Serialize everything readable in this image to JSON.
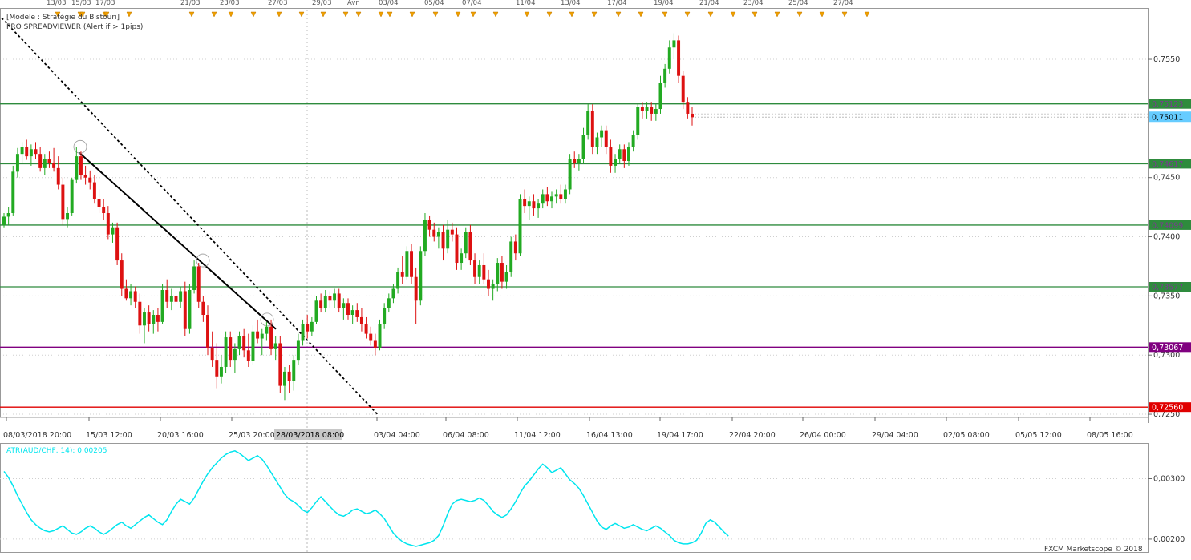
{
  "header": {
    "line1": "[Modele : Stratégie du Bistouri]",
    "line2": "PRO SPREADVIEWER (Alert if > 1pips)"
  },
  "events_axis": {
    "labels": [
      "13/03",
      "15/03",
      "17/03",
      "21/03",
      "23/03",
      "27/03",
      "29/03",
      "Avr",
      "03/04",
      "05/04",
      "07/04",
      "11/04",
      "13/04",
      "17/04",
      "19/04",
      "21/04",
      "23/04",
      "25/04",
      "27/04"
    ]
  },
  "main_axis": {
    "ticks": [
      "0,7550",
      "0,7450",
      "0,7400",
      "0,7350",
      "0,7300",
      "0,7250"
    ],
    "ylim": [
      0.7248,
      0.7592
    ]
  },
  "levels": [
    {
      "value": 0.75123,
      "label": "0,75123",
      "color": "#2e8b3d",
      "label_color": "#7a3b8f"
    },
    {
      "value": 0.74617,
      "label": "0,74617",
      "color": "#2e8b3d",
      "label_color": "#7a3b8f"
    },
    {
      "value": 0.74099,
      "label": "0,74099",
      "color": "#2e8b3d",
      "label_color": "#7a3b8f"
    },
    {
      "value": 0.73577,
      "label": "0,73577",
      "color": "#2e8b3d",
      "label_color": "#7a3b8f"
    },
    {
      "value": 0.73067,
      "label": "0,73067",
      "color": "#800080",
      "label_color": "#ffffff"
    },
    {
      "value": 0.7256,
      "label": "0,72560",
      "color": "#e00000",
      "label_color": "#ffffff"
    }
  ],
  "current_price": {
    "value": 0.75011,
    "label": "0,75011",
    "color": "#66ccff"
  },
  "time_axis": {
    "labels": [
      "08/03/2018 20:00",
      "15/03 12:00",
      "20/03 16:00",
      "25/03 20:00",
      "03/04 04:00",
      "06/04 08:00",
      "11/04 12:00",
      "16/04 13:00",
      "19/04 17:00",
      "22/04 20:00",
      "26/04 00:00",
      "29/04 04:00",
      "02/05 08:00",
      "05/05 12:00",
      "08/05 16:00"
    ],
    "cursor_label": "28/03/2018 08:00"
  },
  "indicator": {
    "label": "ATR(AUD/CHF, 14): 0,00205",
    "ticks": [
      "0,00300",
      "0,00200"
    ],
    "color": "#00e5ee"
  },
  "watermark": "FXCM Marketscope © 2018",
  "colors": {
    "bull": "#22aa22",
    "bear": "#dd1111",
    "grid": "#cfcfcf",
    "frame": "#999999"
  },
  "chart_data": {
    "type": "candlestick",
    "instrument": "AUD/CHF",
    "candles": [
      {
        "o": 0.741,
        "h": 0.742,
        "l": 0.7408,
        "c": 0.7417
      },
      {
        "o": 0.7417,
        "h": 0.7425,
        "l": 0.741,
        "c": 0.742
      },
      {
        "o": 0.742,
        "h": 0.746,
        "l": 0.7418,
        "c": 0.7455
      },
      {
        "o": 0.7455,
        "h": 0.7475,
        "l": 0.745,
        "c": 0.747
      },
      {
        "o": 0.747,
        "h": 0.748,
        "l": 0.7462,
        "c": 0.7476
      },
      {
        "o": 0.7476,
        "h": 0.7482,
        "l": 0.7465,
        "c": 0.7468
      },
      {
        "o": 0.7468,
        "h": 0.7478,
        "l": 0.746,
        "c": 0.7474
      },
      {
        "o": 0.7474,
        "h": 0.748,
        "l": 0.7466,
        "c": 0.747
      },
      {
        "o": 0.747,
        "h": 0.7476,
        "l": 0.7455,
        "c": 0.7458
      },
      {
        "o": 0.7458,
        "h": 0.747,
        "l": 0.7452,
        "c": 0.7466
      },
      {
        "o": 0.7466,
        "h": 0.7472,
        "l": 0.7458,
        "c": 0.7462
      },
      {
        "o": 0.7462,
        "h": 0.7475,
        "l": 0.7455,
        "c": 0.7458
      },
      {
        "o": 0.7458,
        "h": 0.7468,
        "l": 0.744,
        "c": 0.7444
      },
      {
        "o": 0.7444,
        "h": 0.745,
        "l": 0.741,
        "c": 0.7415
      },
      {
        "o": 0.7415,
        "h": 0.7425,
        "l": 0.7408,
        "c": 0.742
      },
      {
        "o": 0.742,
        "h": 0.745,
        "l": 0.7418,
        "c": 0.7448
      },
      {
        "o": 0.7448,
        "h": 0.7476,
        "l": 0.7445,
        "c": 0.7468
      },
      {
        "o": 0.7468,
        "h": 0.7472,
        "l": 0.7448,
        "c": 0.7452
      },
      {
        "o": 0.7452,
        "h": 0.746,
        "l": 0.7444,
        "c": 0.745
      },
      {
        "o": 0.745,
        "h": 0.7456,
        "l": 0.744,
        "c": 0.7446
      },
      {
        "o": 0.7446,
        "h": 0.7452,
        "l": 0.7428,
        "c": 0.7432
      },
      {
        "o": 0.7432,
        "h": 0.744,
        "l": 0.742,
        "c": 0.7425
      },
      {
        "o": 0.7425,
        "h": 0.7432,
        "l": 0.7414,
        "c": 0.742
      },
      {
        "o": 0.742,
        "h": 0.7426,
        "l": 0.7398,
        "c": 0.7402
      },
      {
        "o": 0.7402,
        "h": 0.7412,
        "l": 0.7395,
        "c": 0.7408
      },
      {
        "o": 0.7408,
        "h": 0.7412,
        "l": 0.7376,
        "c": 0.738
      },
      {
        "o": 0.738,
        "h": 0.7386,
        "l": 0.735,
        "c": 0.7356
      },
      {
        "o": 0.7356,
        "h": 0.7364,
        "l": 0.7346,
        "c": 0.7348
      },
      {
        "o": 0.7348,
        "h": 0.736,
        "l": 0.7342,
        "c": 0.7354
      },
      {
        "o": 0.7354,
        "h": 0.7358,
        "l": 0.734,
        "c": 0.7345
      },
      {
        "o": 0.7345,
        "h": 0.7352,
        "l": 0.7318,
        "c": 0.7325
      },
      {
        "o": 0.7325,
        "h": 0.734,
        "l": 0.731,
        "c": 0.7336
      },
      {
        "o": 0.7336,
        "h": 0.7342,
        "l": 0.732,
        "c": 0.7326
      },
      {
        "o": 0.7326,
        "h": 0.7338,
        "l": 0.7318,
        "c": 0.7334
      },
      {
        "o": 0.7334,
        "h": 0.734,
        "l": 0.732,
        "c": 0.7328
      },
      {
        "o": 0.7328,
        "h": 0.736,
        "l": 0.7326,
        "c": 0.7355
      },
      {
        "o": 0.7355,
        "h": 0.7364,
        "l": 0.734,
        "c": 0.7345
      },
      {
        "o": 0.7345,
        "h": 0.7356,
        "l": 0.7338,
        "c": 0.735
      },
      {
        "o": 0.735,
        "h": 0.7356,
        "l": 0.734,
        "c": 0.7345
      },
      {
        "o": 0.7345,
        "h": 0.7358,
        "l": 0.734,
        "c": 0.7354
      },
      {
        "o": 0.7354,
        "h": 0.7362,
        "l": 0.7316,
        "c": 0.7322
      },
      {
        "o": 0.7322,
        "h": 0.736,
        "l": 0.7318,
        "c": 0.7355
      },
      {
        "o": 0.7355,
        "h": 0.738,
        "l": 0.7352,
        "c": 0.7375
      },
      {
        "o": 0.7375,
        "h": 0.7378,
        "l": 0.734,
        "c": 0.7345
      },
      {
        "o": 0.7345,
        "h": 0.735,
        "l": 0.7328,
        "c": 0.7334
      },
      {
        "o": 0.7334,
        "h": 0.7342,
        "l": 0.73,
        "c": 0.7306
      },
      {
        "o": 0.7306,
        "h": 0.732,
        "l": 0.729,
        "c": 0.7296
      },
      {
        "o": 0.7296,
        "h": 0.731,
        "l": 0.7272,
        "c": 0.7282
      },
      {
        "o": 0.7282,
        "h": 0.73,
        "l": 0.7276,
        "c": 0.729
      },
      {
        "o": 0.729,
        "h": 0.732,
        "l": 0.7285,
        "c": 0.7315
      },
      {
        "o": 0.7315,
        "h": 0.732,
        "l": 0.729,
        "c": 0.7296
      },
      {
        "o": 0.7296,
        "h": 0.731,
        "l": 0.7285,
        "c": 0.7305
      },
      {
        "o": 0.7305,
        "h": 0.732,
        "l": 0.73,
        "c": 0.7316
      },
      {
        "o": 0.7316,
        "h": 0.7322,
        "l": 0.7298,
        "c": 0.7304
      },
      {
        "o": 0.7304,
        "h": 0.7318,
        "l": 0.729,
        "c": 0.7295
      },
      {
        "o": 0.7295,
        "h": 0.7325,
        "l": 0.7292,
        "c": 0.732
      },
      {
        "o": 0.732,
        "h": 0.733,
        "l": 0.731,
        "c": 0.7314
      },
      {
        "o": 0.7314,
        "h": 0.7322,
        "l": 0.73,
        "c": 0.7318
      },
      {
        "o": 0.7318,
        "h": 0.7328,
        "l": 0.7312,
        "c": 0.7324
      },
      {
        "o": 0.7324,
        "h": 0.733,
        "l": 0.73,
        "c": 0.7305
      },
      {
        "o": 0.7305,
        "h": 0.7316,
        "l": 0.7296,
        "c": 0.731
      },
      {
        "o": 0.731,
        "h": 0.7316,
        "l": 0.7268,
        "c": 0.7274
      },
      {
        "o": 0.7274,
        "h": 0.729,
        "l": 0.7262,
        "c": 0.7286
      },
      {
        "o": 0.7286,
        "h": 0.7292,
        "l": 0.7268,
        "c": 0.7278
      },
      {
        "o": 0.7278,
        "h": 0.73,
        "l": 0.727,
        "c": 0.7296
      },
      {
        "o": 0.7296,
        "h": 0.7318,
        "l": 0.7292,
        "c": 0.7312
      },
      {
        "o": 0.7312,
        "h": 0.733,
        "l": 0.7308,
        "c": 0.7326
      },
      {
        "o": 0.7326,
        "h": 0.7334,
        "l": 0.7314,
        "c": 0.732
      },
      {
        "o": 0.732,
        "h": 0.7332,
        "l": 0.7316,
        "c": 0.7328
      },
      {
        "o": 0.7328,
        "h": 0.735,
        "l": 0.7326,
        "c": 0.7346
      },
      {
        "o": 0.7346,
        "h": 0.7352,
        "l": 0.7336,
        "c": 0.734
      },
      {
        "o": 0.734,
        "h": 0.7355,
        "l": 0.7336,
        "c": 0.735
      },
      {
        "o": 0.735,
        "h": 0.7354,
        "l": 0.734,
        "c": 0.7346
      },
      {
        "o": 0.7346,
        "h": 0.7356,
        "l": 0.734,
        "c": 0.7352
      },
      {
        "o": 0.7352,
        "h": 0.7356,
        "l": 0.7336,
        "c": 0.734
      },
      {
        "o": 0.734,
        "h": 0.7348,
        "l": 0.733,
        "c": 0.7344
      },
      {
        "o": 0.7344,
        "h": 0.7348,
        "l": 0.733,
        "c": 0.7334
      },
      {
        "o": 0.7334,
        "h": 0.7342,
        "l": 0.7326,
        "c": 0.7338
      },
      {
        "o": 0.7338,
        "h": 0.7344,
        "l": 0.7328,
        "c": 0.7332
      },
      {
        "o": 0.7332,
        "h": 0.734,
        "l": 0.732,
        "c": 0.7326
      },
      {
        "o": 0.7326,
        "h": 0.7332,
        "l": 0.7314,
        "c": 0.7318
      },
      {
        "o": 0.7318,
        "h": 0.7324,
        "l": 0.7308,
        "c": 0.7312
      },
      {
        "o": 0.7312,
        "h": 0.7318,
        "l": 0.73,
        "c": 0.7306
      },
      {
        "o": 0.7306,
        "h": 0.733,
        "l": 0.7304,
        "c": 0.7326
      },
      {
        "o": 0.7326,
        "h": 0.7344,
        "l": 0.7322,
        "c": 0.734
      },
      {
        "o": 0.734,
        "h": 0.7352,
        "l": 0.7336,
        "c": 0.7348
      },
      {
        "o": 0.7348,
        "h": 0.736,
        "l": 0.7344,
        "c": 0.7356
      },
      {
        "o": 0.7356,
        "h": 0.7374,
        "l": 0.7352,
        "c": 0.737
      },
      {
        "o": 0.737,
        "h": 0.7384,
        "l": 0.736,
        "c": 0.7366
      },
      {
        "o": 0.7366,
        "h": 0.7392,
        "l": 0.7364,
        "c": 0.7388
      },
      {
        "o": 0.7388,
        "h": 0.7394,
        "l": 0.736,
        "c": 0.7366
      },
      {
        "o": 0.7366,
        "h": 0.7374,
        "l": 0.7326,
        "c": 0.7346
      },
      {
        "o": 0.7346,
        "h": 0.7392,
        "l": 0.7342,
        "c": 0.7388
      },
      {
        "o": 0.7388,
        "h": 0.742,
        "l": 0.7384,
        "c": 0.7414
      },
      {
        "o": 0.7414,
        "h": 0.7418,
        "l": 0.74,
        "c": 0.7406
      },
      {
        "o": 0.7406,
        "h": 0.7412,
        "l": 0.7396,
        "c": 0.74
      },
      {
        "o": 0.74,
        "h": 0.7408,
        "l": 0.739,
        "c": 0.7404
      },
      {
        "o": 0.7404,
        "h": 0.741,
        "l": 0.738,
        "c": 0.739
      },
      {
        "o": 0.739,
        "h": 0.7414,
        "l": 0.7386,
        "c": 0.7406
      },
      {
        "o": 0.7406,
        "h": 0.7412,
        "l": 0.7396,
        "c": 0.7402
      },
      {
        "o": 0.7402,
        "h": 0.7408,
        "l": 0.7372,
        "c": 0.7378
      },
      {
        "o": 0.7378,
        "h": 0.739,
        "l": 0.7372,
        "c": 0.7386
      },
      {
        "o": 0.7386,
        "h": 0.7408,
        "l": 0.7382,
        "c": 0.7404
      },
      {
        "o": 0.7404,
        "h": 0.741,
        "l": 0.7376,
        "c": 0.738
      },
      {
        "o": 0.738,
        "h": 0.7386,
        "l": 0.736,
        "c": 0.7366
      },
      {
        "o": 0.7366,
        "h": 0.738,
        "l": 0.736,
        "c": 0.7376
      },
      {
        "o": 0.7376,
        "h": 0.7386,
        "l": 0.736,
        "c": 0.7364
      },
      {
        "o": 0.7364,
        "h": 0.7372,
        "l": 0.735,
        "c": 0.7356
      },
      {
        "o": 0.7356,
        "h": 0.7364,
        "l": 0.7346,
        "c": 0.736
      },
      {
        "o": 0.736,
        "h": 0.7382,
        "l": 0.7354,
        "c": 0.7378
      },
      {
        "o": 0.7378,
        "h": 0.7384,
        "l": 0.7356,
        "c": 0.7362
      },
      {
        "o": 0.7362,
        "h": 0.7376,
        "l": 0.7356,
        "c": 0.737
      },
      {
        "o": 0.737,
        "h": 0.74,
        "l": 0.7366,
        "c": 0.7396
      },
      {
        "o": 0.7396,
        "h": 0.7402,
        "l": 0.738,
        "c": 0.7386
      },
      {
        "o": 0.7386,
        "h": 0.7436,
        "l": 0.7384,
        "c": 0.7432
      },
      {
        "o": 0.7432,
        "h": 0.744,
        "l": 0.742,
        "c": 0.7426
      },
      {
        "o": 0.7426,
        "h": 0.7434,
        "l": 0.7414,
        "c": 0.743
      },
      {
        "o": 0.743,
        "h": 0.7436,
        "l": 0.7418,
        "c": 0.7424
      },
      {
        "o": 0.7424,
        "h": 0.7432,
        "l": 0.7416,
        "c": 0.7428
      },
      {
        "o": 0.7428,
        "h": 0.744,
        "l": 0.7424,
        "c": 0.7436
      },
      {
        "o": 0.7436,
        "h": 0.7442,
        "l": 0.7426,
        "c": 0.743
      },
      {
        "o": 0.743,
        "h": 0.7438,
        "l": 0.7424,
        "c": 0.7434
      },
      {
        "o": 0.7434,
        "h": 0.744,
        "l": 0.7428,
        "c": 0.7436
      },
      {
        "o": 0.7436,
        "h": 0.7444,
        "l": 0.7428,
        "c": 0.7432
      },
      {
        "o": 0.7432,
        "h": 0.7444,
        "l": 0.7428,
        "c": 0.744
      },
      {
        "o": 0.744,
        "h": 0.747,
        "l": 0.7436,
        "c": 0.7466
      },
      {
        "o": 0.7466,
        "h": 0.7472,
        "l": 0.7458,
        "c": 0.7462
      },
      {
        "o": 0.7462,
        "h": 0.747,
        "l": 0.7456,
        "c": 0.7466
      },
      {
        "o": 0.7466,
        "h": 0.7492,
        "l": 0.7462,
        "c": 0.7486
      },
      {
        "o": 0.7486,
        "h": 0.7512,
        "l": 0.7482,
        "c": 0.7506
      },
      {
        "o": 0.7506,
        "h": 0.7512,
        "l": 0.747,
        "c": 0.7476
      },
      {
        "o": 0.7476,
        "h": 0.7488,
        "l": 0.747,
        "c": 0.7484
      },
      {
        "o": 0.7484,
        "h": 0.7494,
        "l": 0.7476,
        "c": 0.749
      },
      {
        "o": 0.749,
        "h": 0.7494,
        "l": 0.747,
        "c": 0.7476
      },
      {
        "o": 0.7476,
        "h": 0.7482,
        "l": 0.7454,
        "c": 0.746
      },
      {
        "o": 0.746,
        "h": 0.747,
        "l": 0.7454,
        "c": 0.7466
      },
      {
        "o": 0.7466,
        "h": 0.7478,
        "l": 0.7462,
        "c": 0.7474
      },
      {
        "o": 0.7474,
        "h": 0.7478,
        "l": 0.7458,
        "c": 0.7464
      },
      {
        "o": 0.7464,
        "h": 0.748,
        "l": 0.746,
        "c": 0.7476
      },
      {
        "o": 0.7476,
        "h": 0.749,
        "l": 0.7472,
        "c": 0.7486
      },
      {
        "o": 0.7486,
        "h": 0.7512,
        "l": 0.7482,
        "c": 0.751
      },
      {
        "o": 0.751,
        "h": 0.7514,
        "l": 0.75,
        "c": 0.7506
      },
      {
        "o": 0.7506,
        "h": 0.7514,
        "l": 0.75,
        "c": 0.751
      },
      {
        "o": 0.751,
        "h": 0.7514,
        "l": 0.7498,
        "c": 0.7504
      },
      {
        "o": 0.7504,
        "h": 0.7512,
        "l": 0.7498,
        "c": 0.7508
      },
      {
        "o": 0.7508,
        "h": 0.7536,
        "l": 0.7504,
        "c": 0.753
      },
      {
        "o": 0.753,
        "h": 0.7546,
        "l": 0.7526,
        "c": 0.7542
      },
      {
        "o": 0.7542,
        "h": 0.7566,
        "l": 0.7538,
        "c": 0.756
      },
      {
        "o": 0.756,
        "h": 0.7572,
        "l": 0.755,
        "c": 0.7566
      },
      {
        "o": 0.7566,
        "h": 0.757,
        "l": 0.753,
        "c": 0.7536
      },
      {
        "o": 0.7536,
        "h": 0.754,
        "l": 0.7508,
        "c": 0.7514
      },
      {
        "o": 0.7514,
        "h": 0.7518,
        "l": 0.75,
        "c": 0.7504
      },
      {
        "o": 0.7504,
        "h": 0.751,
        "l": 0.7494,
        "c": 0.7501
      }
    ],
    "atr": [
      0.00312,
      0.00302,
      0.00288,
      0.00272,
      0.00258,
      0.00244,
      0.00232,
      0.00224,
      0.00218,
      0.00214,
      0.00212,
      0.00214,
      0.00218,
      0.00222,
      0.00216,
      0.0021,
      0.00208,
      0.00212,
      0.00218,
      0.00222,
      0.00218,
      0.00212,
      0.00208,
      0.00212,
      0.00218,
      0.00224,
      0.00228,
      0.00222,
      0.00218,
      0.00224,
      0.0023,
      0.00236,
      0.0024,
      0.00234,
      0.00228,
      0.00224,
      0.00232,
      0.00246,
      0.00258,
      0.00266,
      0.00262,
      0.00258,
      0.00268,
      0.00282,
      0.00296,
      0.00308,
      0.00318,
      0.00326,
      0.00334,
      0.0034,
      0.00344,
      0.00346,
      0.00342,
      0.00336,
      0.0033,
      0.00334,
      0.00338,
      0.00332,
      0.00322,
      0.0031,
      0.00298,
      0.00286,
      0.00274,
      0.00266,
      0.00262,
      0.00256,
      0.00248,
      0.00244,
      0.00252,
      0.00262,
      0.0027,
      0.00262,
      0.00254,
      0.00246,
      0.0024,
      0.00238,
      0.00242,
      0.00248,
      0.0025,
      0.00246,
      0.00242,
      0.00244,
      0.00248,
      0.00242,
      0.00234,
      0.00222,
      0.0021,
      0.00202,
      0.00196,
      0.00192,
      0.0019,
      0.00188,
      0.0019,
      0.00192,
      0.00194,
      0.00198,
      0.00206,
      0.00222,
      0.00242,
      0.00258,
      0.00264,
      0.00266,
      0.00264,
      0.00262,
      0.00264,
      0.00268,
      0.00264,
      0.00256,
      0.00246,
      0.0024,
      0.00236,
      0.0024,
      0.0025,
      0.00262,
      0.00276,
      0.00288,
      0.00296,
      0.00306,
      0.00316,
      0.00324,
      0.00318,
      0.0031,
      0.00314,
      0.00318,
      0.00308,
      0.00298,
      0.00292,
      0.00284,
      0.00272,
      0.00258,
      0.00244,
      0.0023,
      0.0022,
      0.00216,
      0.00222,
      0.00226,
      0.00222,
      0.00218,
      0.0022,
      0.00224,
      0.0022,
      0.00216,
      0.00214,
      0.00218,
      0.00222,
      0.00218,
      0.00212,
      0.00206,
      0.00198,
      0.00194,
      0.00192,
      0.00192,
      0.00194,
      0.00198,
      0.0021,
      0.00226,
      0.00232,
      0.00228,
      0.0022,
      0.00212,
      0.00205
    ]
  }
}
